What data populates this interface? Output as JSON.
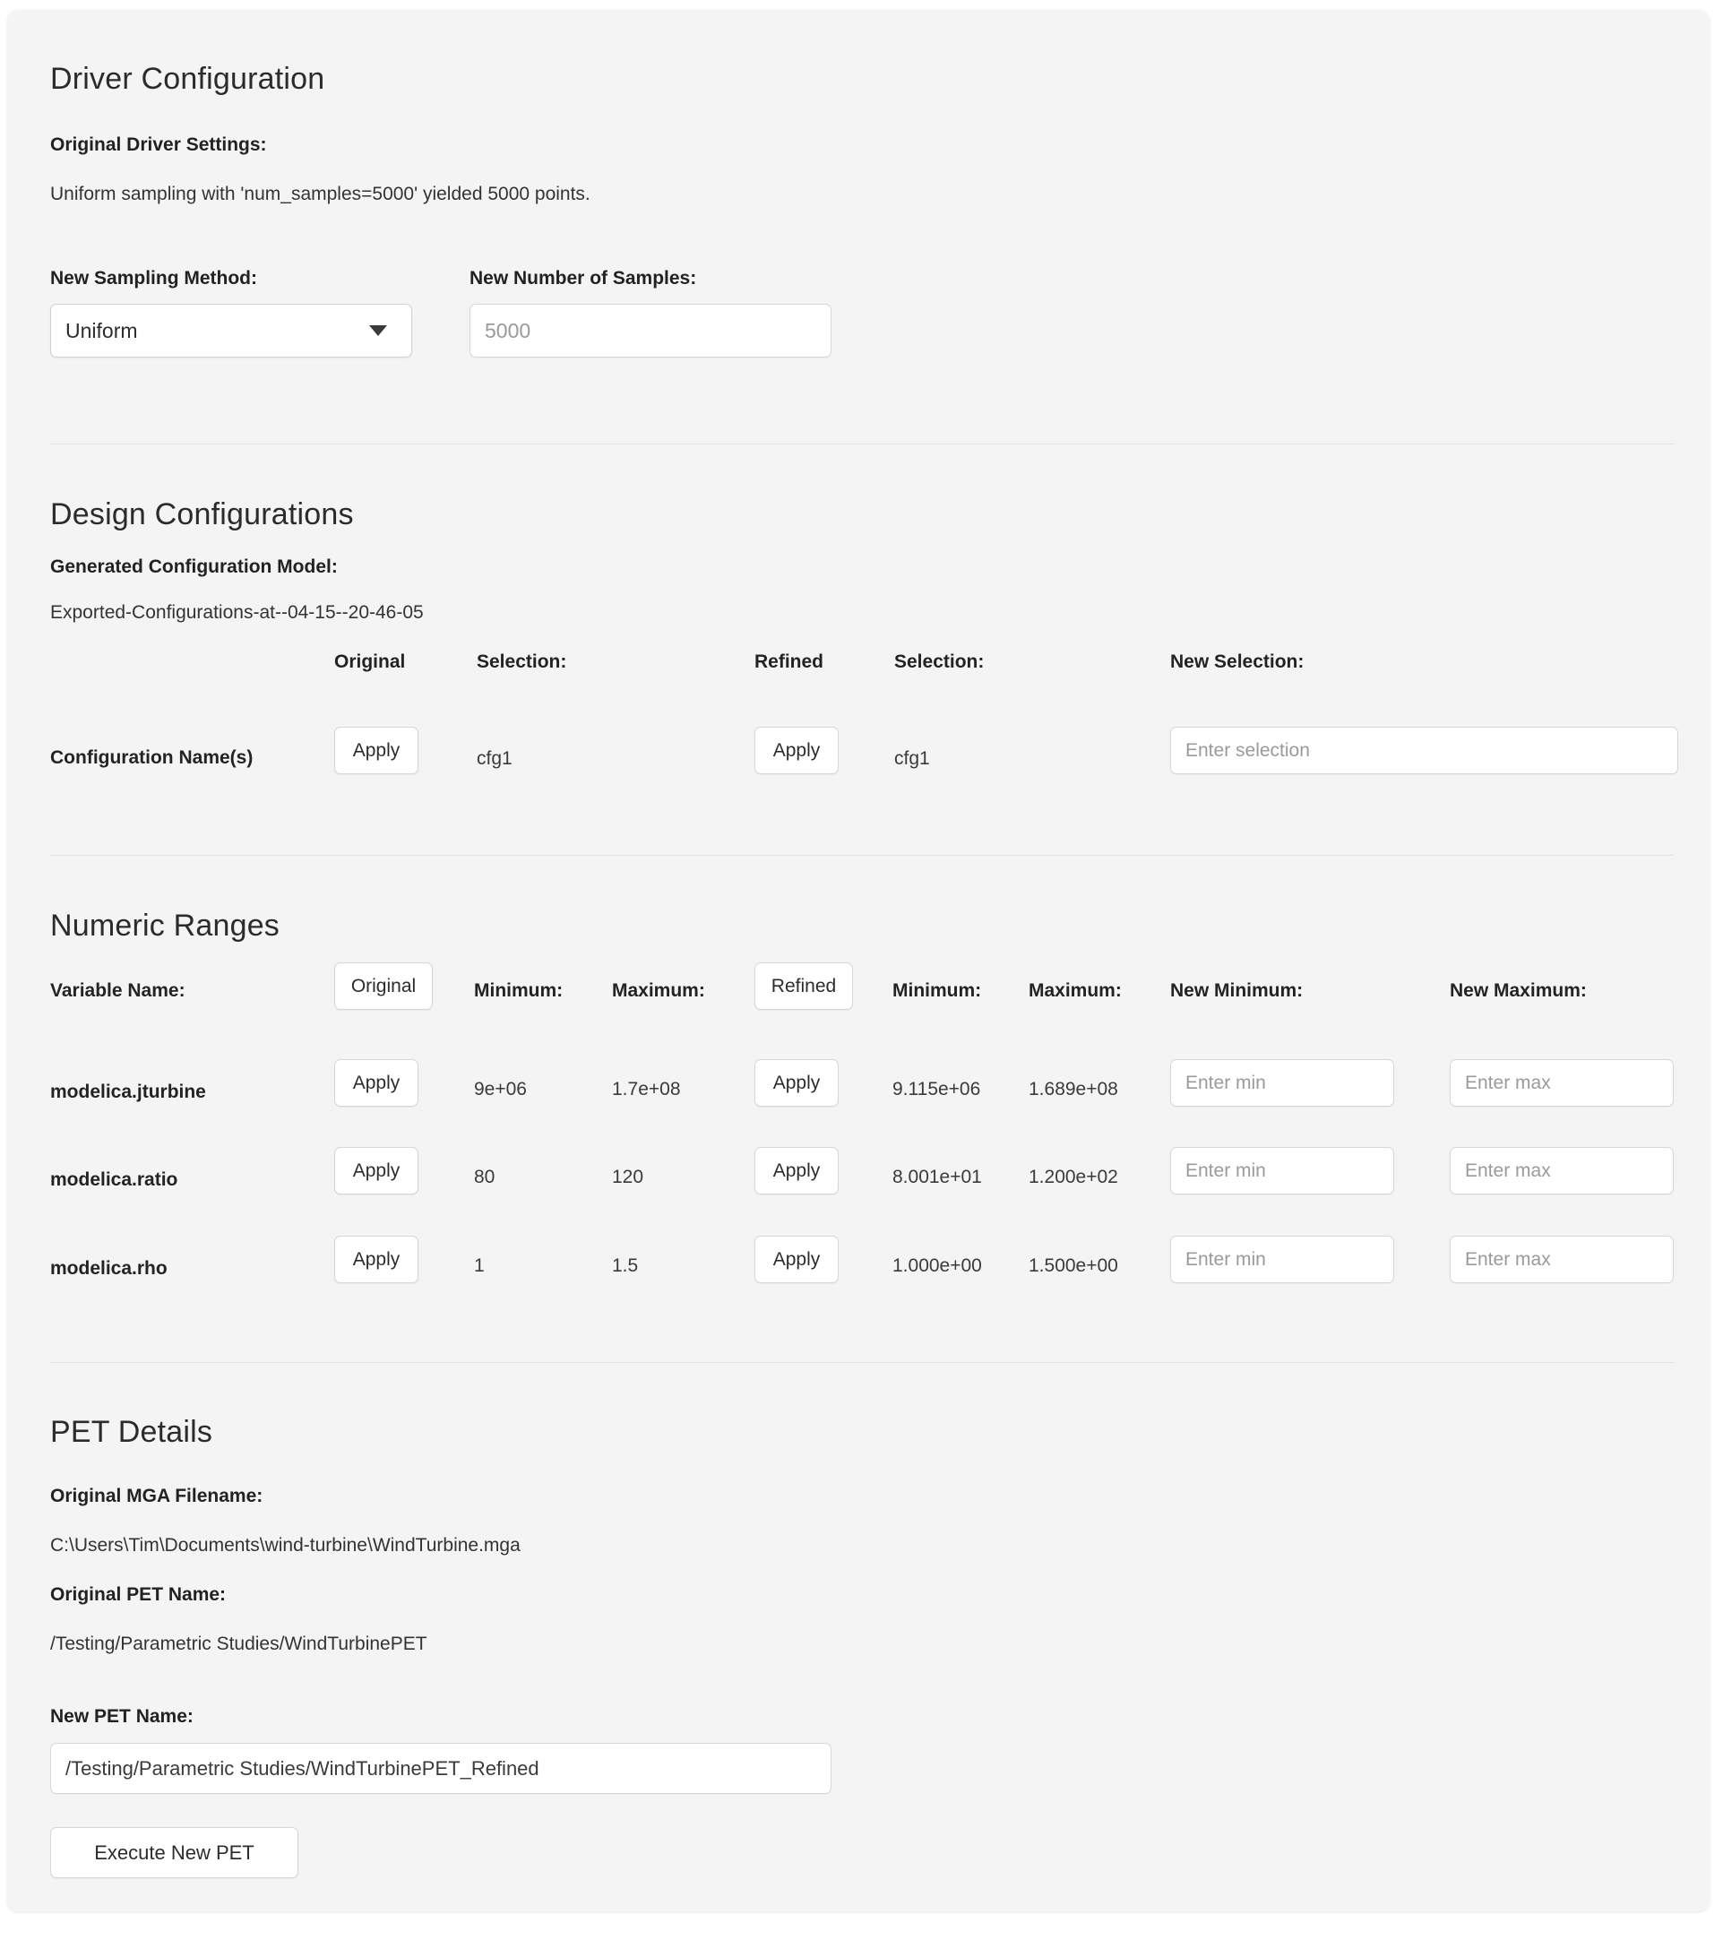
{
  "driver": {
    "section_title": "Driver Configuration",
    "original_settings_label": "Original Driver Settings:",
    "original_settings_text": "Uniform sampling with 'num_samples=5000' yielded 5000 points.",
    "sampling_method_label": "New Sampling Method:",
    "sampling_method_value": "Uniform",
    "num_samples_label": "New Number of Samples:",
    "num_samples_placeholder": "5000"
  },
  "design": {
    "section_title": "Design Configurations",
    "generated_model_label": "Generated Configuration Model:",
    "generated_model_value": "Exported-Configurations-at--04-15--20-46-05",
    "headers": {
      "original": "Original",
      "original_selection": "Selection:",
      "refined": "Refined",
      "refined_selection": "Selection:",
      "new_selection": "New Selection:"
    },
    "row": {
      "label": "Configuration Name(s)",
      "original_apply": "Apply",
      "original_value": "cfg1",
      "refined_apply": "Apply",
      "refined_value": "cfg1",
      "new_selection_placeholder": "Enter selection"
    }
  },
  "numeric": {
    "section_title": "Numeric Ranges",
    "headers": {
      "variable_name": "Variable Name:",
      "original": "Original",
      "original_min": "Minimum:",
      "original_max": "Maximum:",
      "refined": "Refined",
      "refined_min": "Minimum:",
      "refined_max": "Maximum:",
      "new_min": "New Minimum:",
      "new_max": "New Maximum:"
    },
    "apply_label": "Apply",
    "new_min_placeholder": "Enter min",
    "new_max_placeholder": "Enter max",
    "rows": [
      {
        "name": "modelica.jturbine",
        "original_min": "9e+06",
        "original_max": "1.7e+08",
        "refined_min": "9.115e+06",
        "refined_max": "1.689e+08"
      },
      {
        "name": "modelica.ratio",
        "original_min": "80",
        "original_max": "120",
        "refined_min": "8.001e+01",
        "refined_max": "1.200e+02"
      },
      {
        "name": "modelica.rho",
        "original_min": "1",
        "original_max": "1.5",
        "refined_min": "1.000e+00",
        "refined_max": "1.500e+00"
      }
    ]
  },
  "pet": {
    "section_title": "PET Details",
    "mga_filename_label": "Original MGA Filename:",
    "mga_filename_value": "C:\\Users\\Tim\\Documents\\wind-turbine\\WindTurbine.mga",
    "pet_name_label": "Original PET Name:",
    "pet_name_value": "/Testing/Parametric Studies/WindTurbinePET",
    "new_pet_name_label": "New PET Name:",
    "new_pet_name_value": "/Testing/Parametric Studies/WindTurbinePET_Refined",
    "execute_button": "Execute New PET"
  }
}
